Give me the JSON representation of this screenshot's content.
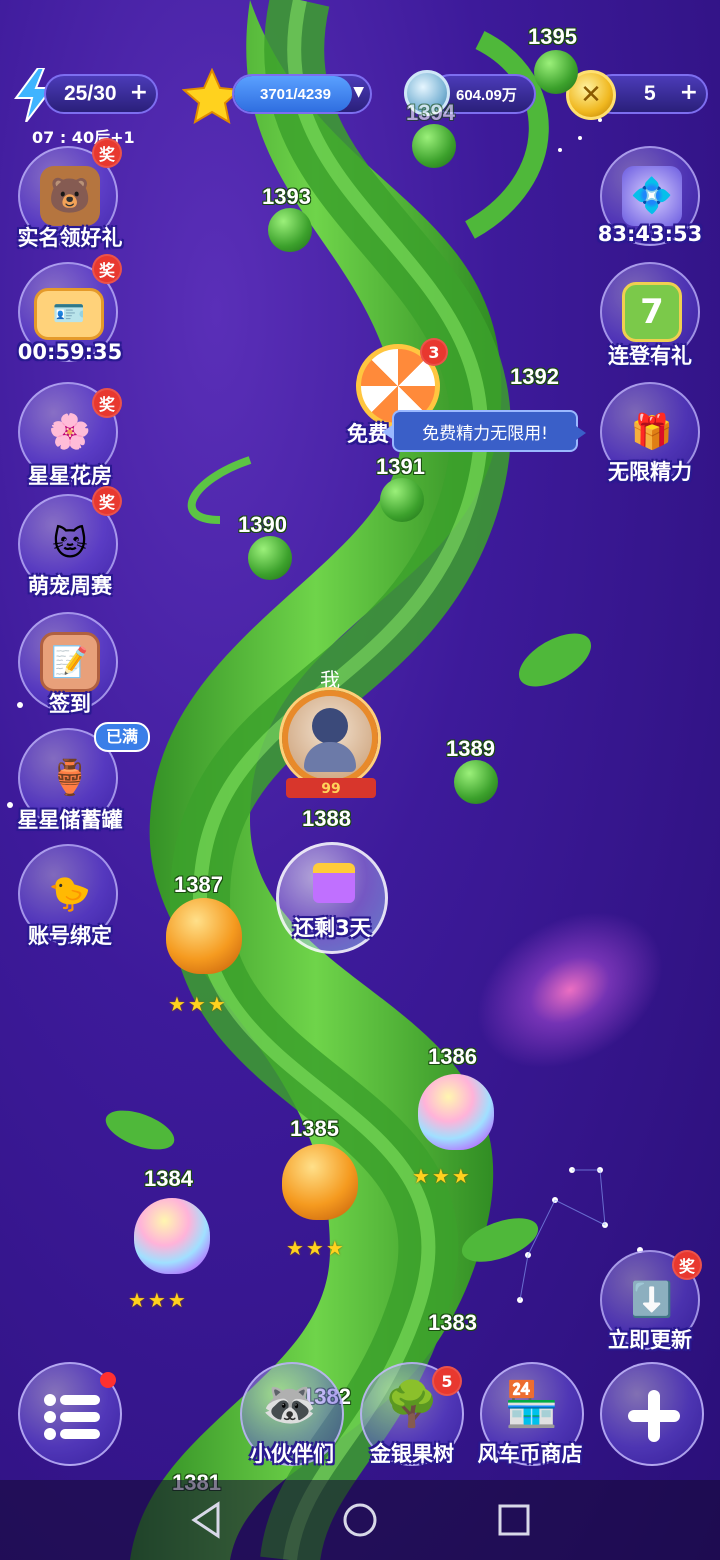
{
  "top_bar": {
    "energy": "25/30",
    "energy_timer": "07 : 40后+1",
    "stars": "3701/4239",
    "coins": "604.09万",
    "gold": "5"
  },
  "left_menu": [
    {
      "label": "实名领好礼",
      "badge": "奖"
    },
    {
      "label": "00:59:35",
      "badge": "奖"
    },
    {
      "label": "星星花房",
      "badge": "奖"
    },
    {
      "label": "萌宠周赛",
      "badge": "奖"
    },
    {
      "label": "签到"
    },
    {
      "label": "星星储蓄罐",
      "badge": "已满"
    },
    {
      "label": "账号绑定"
    }
  ],
  "right_menu": [
    {
      "label": "83:43:53"
    },
    {
      "label": "连登有礼"
    },
    {
      "label": "无限精力"
    },
    {
      "label": "立即更新",
      "badge": "奖"
    }
  ],
  "free_energy": {
    "label": "免费",
    "badge": "3",
    "tooltip": "免费精力无限用!"
  },
  "player": {
    "label": "我",
    "level": "99"
  },
  "gift": {
    "label": "还剩3天"
  },
  "levels": [
    "1395",
    "1394",
    "1393",
    "1392",
    "1391",
    "1390",
    "1389",
    "1388",
    "1387",
    "1386",
    "1385",
    "1384",
    "1383",
    "1382",
    "1381"
  ],
  "bottom_menu": {
    "partners": "小伙伴们",
    "tree": "金银果树",
    "tree_badge": "5",
    "shop": "风车币商店"
  },
  "colors": {
    "accent": "#7d6ef0",
    "badge_red": "#e8382f",
    "vine": "#4fb83a"
  }
}
